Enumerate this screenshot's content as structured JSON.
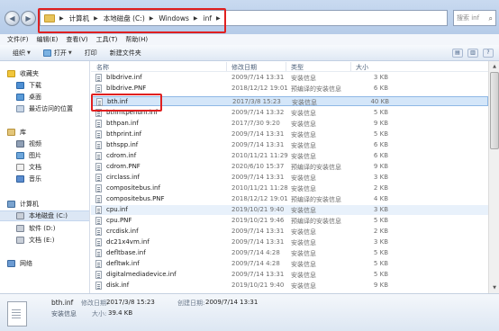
{
  "address": {
    "crumbs": [
      "计算机",
      "本地磁盘 (C:)",
      "Windows",
      "inf"
    ],
    "search_placeholder": "搜索 inf"
  },
  "menu": [
    "文件(F)",
    "编辑(E)",
    "查看(V)",
    "工具(T)",
    "帮助(H)"
  ],
  "toolbar": {
    "organize": "组织",
    "open": "打开",
    "print": "打印",
    "new_folder": "新建文件夹"
  },
  "sidebar": {
    "items": [
      {
        "label": "收藏夹",
        "icon": "star-icon"
      },
      {
        "label": "下载",
        "icon": "download-folder-icon"
      },
      {
        "label": "桌面",
        "icon": "desktop-icon"
      },
      {
        "label": "最近访问的位置",
        "icon": "recent-places-icon"
      },
      {
        "label": "库",
        "icon": "library-icon"
      },
      {
        "label": "视频",
        "icon": "video-icon"
      },
      {
        "label": "图片",
        "icon": "picture-icon"
      },
      {
        "label": "文档",
        "icon": "document-icon"
      },
      {
        "label": "音乐",
        "icon": "music-icon"
      },
      {
        "label": "计算机",
        "icon": "computer-icon"
      },
      {
        "label": "本地磁盘 (C:)",
        "icon": "drive-icon"
      },
      {
        "label": "软件 (D:)",
        "icon": "drive-icon"
      },
      {
        "label": "文档 (E:)",
        "icon": "drive-icon"
      },
      {
        "label": "网络",
        "icon": "network-icon"
      }
    ]
  },
  "columns": {
    "name": "名称",
    "date": "修改日期",
    "type": "类型",
    "size": "大小"
  },
  "files": [
    {
      "name": "blbdrive.inf",
      "date": "2009/7/14 13:31",
      "type": "安装信息",
      "size": "3 KB"
    },
    {
      "name": "blbdrive.PNF",
      "date": "2018/12/12 19:01",
      "type": "预编译的安装信息",
      "size": "6 KB"
    },
    {
      "name": "bth.inf",
      "date": "2017/3/8 15:23",
      "type": "安装信息",
      "size": "40 KB"
    },
    {
      "name": "bthmtpenum.inf",
      "date": "2009/7/14 13:32",
      "type": "安装信息",
      "size": "5 KB"
    },
    {
      "name": "bthpan.inf",
      "date": "2017/7/30 9:20",
      "type": "安装信息",
      "size": "9 KB"
    },
    {
      "name": "bthprint.inf",
      "date": "2009/7/14 13:31",
      "type": "安装信息",
      "size": "5 KB"
    },
    {
      "name": "bthspp.inf",
      "date": "2009/7/14 13:31",
      "type": "安装信息",
      "size": "6 KB"
    },
    {
      "name": "cdrom.inf",
      "date": "2010/11/21 11:29",
      "type": "安装信息",
      "size": "6 KB"
    },
    {
      "name": "cdrom.PNF",
      "date": "2020/6/10 15:37",
      "type": "预编译的安装信息",
      "size": "9 KB"
    },
    {
      "name": "circlass.inf",
      "date": "2009/7/14 13:31",
      "type": "安装信息",
      "size": "3 KB"
    },
    {
      "name": "compositebus.inf",
      "date": "2010/11/21 11:28",
      "type": "安装信息",
      "size": "2 KB"
    },
    {
      "name": "compositebus.PNF",
      "date": "2018/12/12 19:01",
      "type": "预编译的安装信息",
      "size": "4 KB"
    },
    {
      "name": "cpu.inf",
      "date": "2019/10/21 9:40",
      "type": "安装信息",
      "size": "3 KB"
    },
    {
      "name": "cpu.PNF",
      "date": "2019/10/21 9:46",
      "type": "预编译的安装信息",
      "size": "5 KB"
    },
    {
      "name": "crcdisk.inf",
      "date": "2009/7/14 13:31",
      "type": "安装信息",
      "size": "2 KB"
    },
    {
      "name": "dc21x4vm.inf",
      "date": "2009/7/14 13:31",
      "type": "安装信息",
      "size": "3 KB"
    },
    {
      "name": "defltbase.inf",
      "date": "2009/7/14 4:28",
      "type": "安装信息",
      "size": "5 KB"
    },
    {
      "name": "defltwk.inf",
      "date": "2009/7/14 4:28",
      "type": "安装信息",
      "size": "5 KB"
    },
    {
      "name": "digitalmediadevice.inf",
      "date": "2009/7/14 13:31",
      "type": "安装信息",
      "size": "5 KB"
    },
    {
      "name": "disk.inf",
      "date": "2019/10/21 9:40",
      "type": "安装信息",
      "size": "9 KB"
    }
  ],
  "details": {
    "name": "bth.inf",
    "modified_label": "修改日期:",
    "modified": "2017/3/8 15:23",
    "created_label": "创建日期:",
    "created": "2009/7/14 13:31",
    "type": "安装信息",
    "size_label": "大小:",
    "size": "39.4 KB"
  }
}
